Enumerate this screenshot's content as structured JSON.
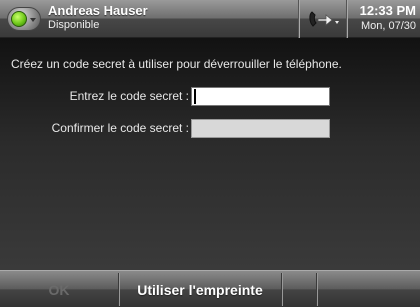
{
  "header": {
    "user_name": "Andreas Hauser",
    "presence_status": "Disponible",
    "time": "12:33 PM",
    "date": "Mon, 07/30",
    "presence_color": "#6fc81a",
    "call_icon": "call-forward-icon"
  },
  "main": {
    "instruction": "Créez un code secret à utiliser pour déverrouiller le téléphone.",
    "fields": [
      {
        "label": "Entrez le code secret :",
        "value": ""
      },
      {
        "label": "Confirmer le code secret :",
        "value": ""
      }
    ]
  },
  "softkeys": {
    "ok": "OK",
    "fingerprint": "Utiliser l'empreinte",
    "empty_3": "",
    "empty_4": ""
  }
}
